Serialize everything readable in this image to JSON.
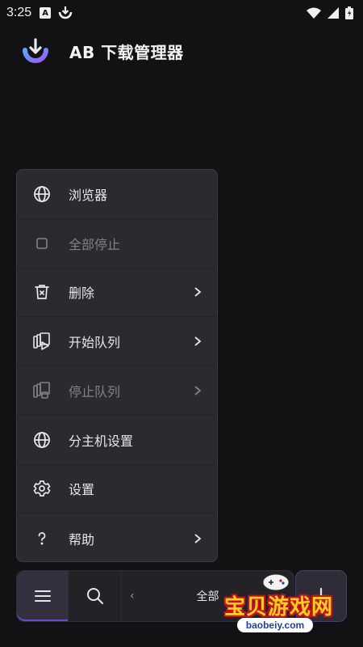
{
  "status_bar": {
    "time": "3:25"
  },
  "header": {
    "title": "AB 下载管理器"
  },
  "menu": {
    "items": [
      {
        "label": "浏览器",
        "icon": "globe-icon",
        "disabled": false,
        "has_submenu": false
      },
      {
        "label": "全部停止",
        "icon": "stop-square-icon",
        "disabled": true,
        "has_submenu": false
      },
      {
        "label": "删除",
        "icon": "trash-icon",
        "disabled": false,
        "has_submenu": true
      },
      {
        "label": "开始队列",
        "icon": "queue-start-icon",
        "disabled": false,
        "has_submenu": true
      },
      {
        "label": "停止队列",
        "icon": "queue-stop-icon",
        "disabled": true,
        "has_submenu": true
      },
      {
        "label": "分主机设置",
        "icon": "globe-icon",
        "disabled": false,
        "has_submenu": false
      },
      {
        "label": "设置",
        "icon": "gear-icon",
        "disabled": false,
        "has_submenu": false
      },
      {
        "label": "帮助",
        "icon": "question-icon",
        "disabled": false,
        "has_submenu": true
      }
    ]
  },
  "bottom_bar": {
    "filter_label": "全部",
    "prev_glyph": "‹",
    "next_glyph": "›"
  },
  "watermark": {
    "text": "宝贝游戏网",
    "url": "baobeiy.com"
  },
  "colors": {
    "background": "#121214",
    "menu": "#2b2b2f",
    "accent": "#7c5cf0"
  }
}
